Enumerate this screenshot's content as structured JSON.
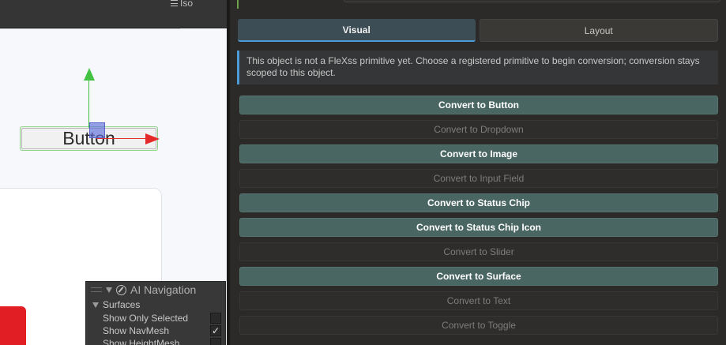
{
  "scene": {
    "view_mode": "Iso",
    "sample_button_text": "Button"
  },
  "ai_navigation": {
    "title": "AI Navigation",
    "section": "Surfaces",
    "options": [
      {
        "label": "Show Only Selected",
        "checked": false
      },
      {
        "label": "Show NavMesh",
        "checked": true
      },
      {
        "label": "Show HeightMesh",
        "checked": false
      }
    ]
  },
  "inspector": {
    "tabs": [
      {
        "label": "Visual",
        "active": true
      },
      {
        "label": "Layout",
        "active": false
      }
    ],
    "info_message": "This object is not a FleXss primitive yet. Choose a registered primitive to begin conversion; conversion stays scoped to this object.",
    "convert_buttons": [
      {
        "label": "Convert to Button",
        "enabled": true
      },
      {
        "label": "Convert to Dropdown",
        "enabled": false
      },
      {
        "label": "Convert to Image",
        "enabled": true
      },
      {
        "label": "Convert to Input Field",
        "enabled": false
      },
      {
        "label": "Convert to Status Chip",
        "enabled": true
      },
      {
        "label": "Convert to Status Chip Icon",
        "enabled": true
      },
      {
        "label": "Convert to Slider",
        "enabled": false
      },
      {
        "label": "Convert to Surface",
        "enabled": true
      },
      {
        "label": "Convert to Text",
        "enabled": false
      },
      {
        "label": "Convert to Toggle",
        "enabled": false
      }
    ]
  },
  "colors": {
    "enabled_button": "#4a6663",
    "disabled_button": "#2e2d2b",
    "active_tab_underline": "#4a9bd6",
    "info_accent": "#4a9bd6",
    "gizmo_x": "#e42a2a",
    "gizmo_y": "#44c244"
  }
}
